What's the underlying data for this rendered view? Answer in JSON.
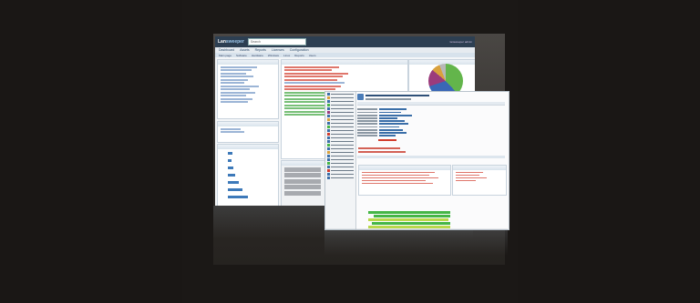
{
  "app": {
    "logo_prefix": "Lan",
    "logo_main": "sweeper",
    "search_placeholder": "Search",
    "user_info": "lansweeper admin"
  },
  "menu": [
    "Dashboard",
    "Assets",
    "Reports",
    "Licenses",
    "Configuration"
  ],
  "subnav": [
    "Main page",
    "Software",
    "Hardware",
    "Windows",
    "Linux",
    "Reports",
    "Users"
  ],
  "colors": {
    "header": "#2d3f52",
    "accent": "#3d79b9",
    "alert": "#d23c2c",
    "ok": "#45b646"
  }
}
